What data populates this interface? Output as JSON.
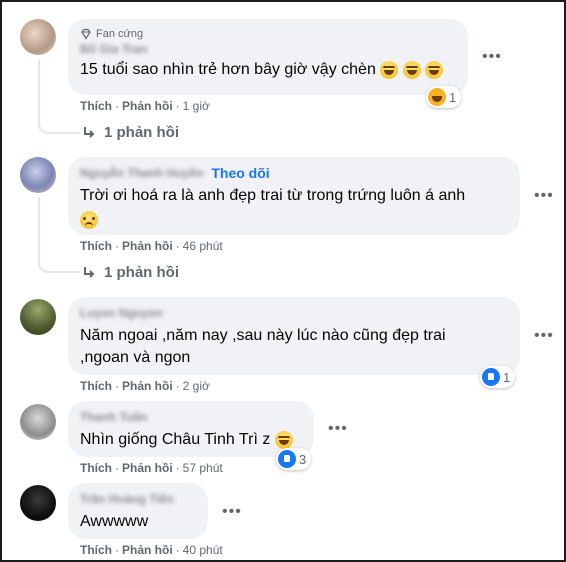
{
  "comments": [
    {
      "badge": "Fan cứng",
      "author": "Bố Gia Tran",
      "text": "15 tuổi sao nhìn trẻ hơn bây giờ vậy chèn",
      "like": "Thích",
      "reply": "Phản hồi",
      "time": "1 giờ",
      "reaction_count": "1",
      "replies_label": "1 phản hồi",
      "emoji": "laugh"
    },
    {
      "author": "Nguyễn Thanh Huyền",
      "follow": "Theo dõi",
      "text": "Trời ơi hoá ra là anh đẹp trai từ trong trứng luôn á anh",
      "like": "Thích",
      "reply": "Phản hồi",
      "time": "46 phút",
      "replies_label": "1 phản hồi",
      "emoji": "sad"
    },
    {
      "author": "Luyen Nguyen",
      "text_line1": "Năm ngoai ,năm nay ,sau này lúc nào cũng đẹp trai",
      "text_line2": ",ngoan và ngon",
      "like": "Thích",
      "reply": "Phản hồi",
      "time": "2 giờ",
      "reaction_count": "1",
      "reaction": "like"
    },
    {
      "author": "Thanh Tuấn",
      "text": "Nhìn giống Châu Tinh Trì z",
      "like": "Thích",
      "reply": "Phản hồi",
      "time": "57 phút",
      "reaction_count": "3",
      "reaction": "like-haha",
      "emoji": "laugh"
    },
    {
      "author": "Trần Hoàng Tiến",
      "text": "Awwwww",
      "like": "Thích",
      "reply": "Phản hồi",
      "time": "40 phút"
    }
  ],
  "icons": {
    "more": "more-options-icon",
    "reply_arrow": "reply-arrow-icon",
    "fan_badge": "diamond-icon"
  },
  "colors": {
    "bubble": "#f0f2f5",
    "link_blue": "#1877f2",
    "meta_gray": "#65676b"
  }
}
